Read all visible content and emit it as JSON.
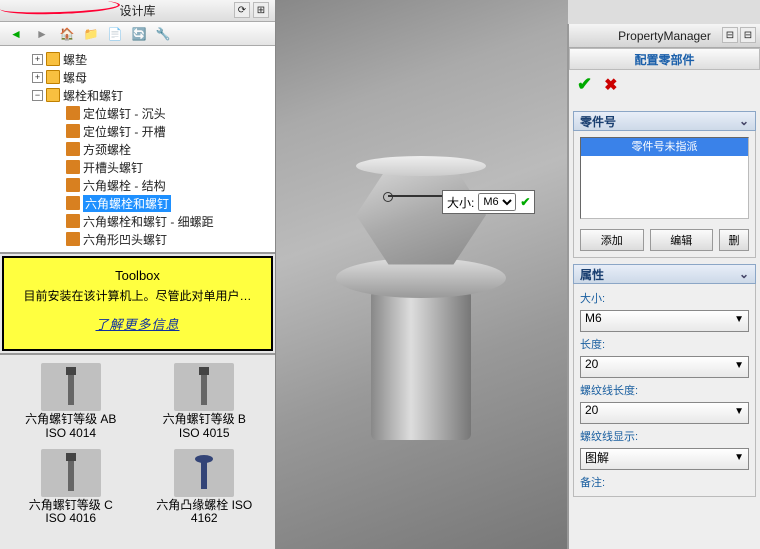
{
  "left": {
    "title": "设计库",
    "tree": {
      "washer": "螺垫",
      "nut": "螺母",
      "bolts": "螺栓和螺钉",
      "items": [
        "定位螺钉 - 沉头",
        "定位螺钉 - 开槽",
        "方颈螺栓",
        "开槽头螺钉",
        "六角螺栓 - 结构",
        "六角螺栓和螺钉",
        "六角螺栓和螺钉 - 细螺距",
        "六角形凹头螺钉"
      ],
      "selected_index": 5
    },
    "toolbox": {
      "title": "Toolbox",
      "text": "目前安装在该计算机上。尽管此对单用户…",
      "link": "了解更多信息"
    },
    "parts": [
      {
        "name": "六角螺钉等级 AB",
        "iso": "ISO 4014"
      },
      {
        "name": "六角螺钉等级 B",
        "iso": "ISO 4015"
      },
      {
        "name": "六角螺钉等级 C",
        "iso": "ISO 4016"
      },
      {
        "name": "六角凸缘螺栓 ISO",
        "iso": "4162"
      }
    ]
  },
  "callout": {
    "label": "大小:",
    "value": "M6"
  },
  "pm": {
    "title": "PropertyManager",
    "config_title": "配置零部件",
    "partno": {
      "header": "零件号",
      "item": "零件号未指派",
      "add": "添加",
      "edit": "编辑",
      "del": "删"
    },
    "props": {
      "header": "属性",
      "size_label": "大小:",
      "size_value": "M6",
      "length_label": "长度:",
      "length_value": "20",
      "thread_len_label": "螺纹线长度:",
      "thread_len_value": "20",
      "thread_disp_label": "螺纹线显示:",
      "thread_disp_value": "图解",
      "notes_label": "备注:"
    }
  }
}
